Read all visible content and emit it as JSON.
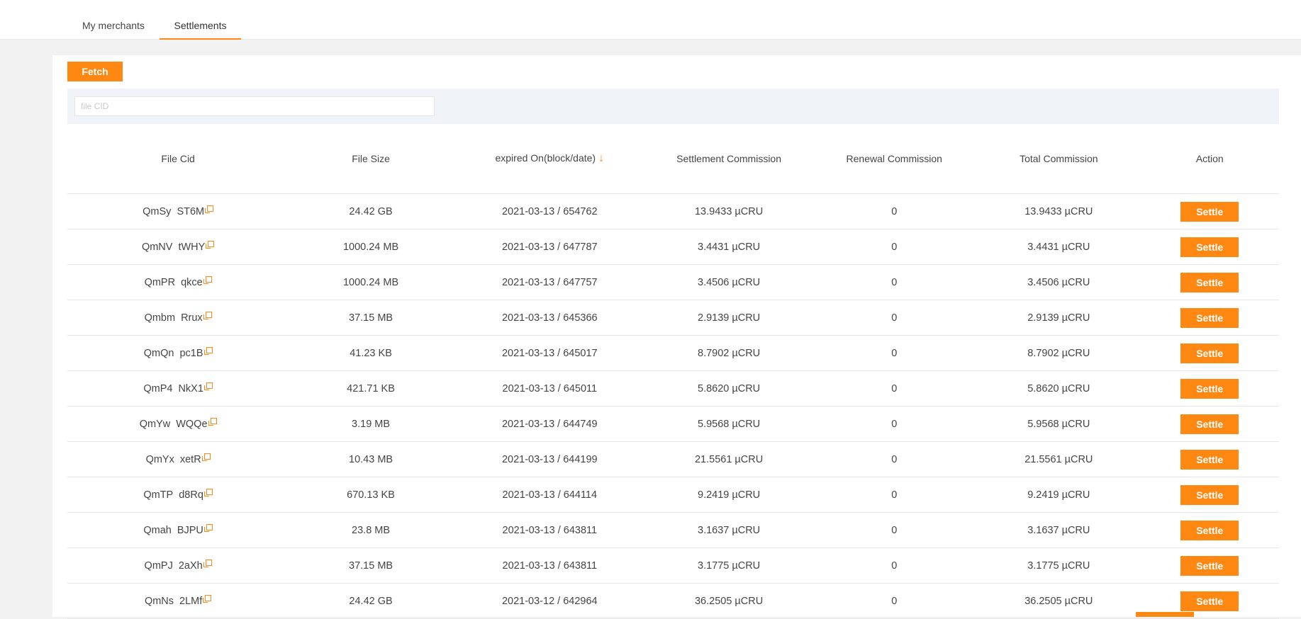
{
  "tabs": [
    {
      "label": "My merchants",
      "active": false
    },
    {
      "label": "Settlements",
      "active": true
    }
  ],
  "toolbar": {
    "fetch_label": "Fetch"
  },
  "filter": {
    "placeholder": "file CID",
    "value": ""
  },
  "table": {
    "columns": [
      "File Cid",
      "File Size",
      "expired On(block/date)",
      "Settlement Commission",
      "Renewal Commission",
      "Total Commission",
      "Action"
    ],
    "sort_indicator": "↓",
    "action_label": "Settle",
    "rows": [
      {
        "cid_start": "QmSy",
        "cid_end": "ST6M",
        "size": "24.42 GB",
        "expired": "2021-03-13 / 654762",
        "settlement": "13.9433 µCRU",
        "renewal": "0",
        "total": "13.9433 µCRU"
      },
      {
        "cid_start": "QmNV",
        "cid_end": "tWHY",
        "size": "1000.24 MB",
        "expired": "2021-03-13 / 647787",
        "settlement": "3.4431 µCRU",
        "renewal": "0",
        "total": "3.4431 µCRU"
      },
      {
        "cid_start": "QmPR",
        "cid_end": "qkce",
        "size": "1000.24 MB",
        "expired": "2021-03-13 / 647757",
        "settlement": "3.4506 µCRU",
        "renewal": "0",
        "total": "3.4506 µCRU"
      },
      {
        "cid_start": "Qmbm",
        "cid_end": "Rrux",
        "size": "37.15 MB",
        "expired": "2021-03-13 / 645366",
        "settlement": "2.9139 µCRU",
        "renewal": "0",
        "total": "2.9139 µCRU"
      },
      {
        "cid_start": "QmQn",
        "cid_end": "pc1B",
        "size": "41.23 KB",
        "expired": "2021-03-13 / 645017",
        "settlement": "8.7902 µCRU",
        "renewal": "0",
        "total": "8.7902 µCRU"
      },
      {
        "cid_start": "QmP4",
        "cid_end": "NkX1",
        "size": "421.71 KB",
        "expired": "2021-03-13 / 645011",
        "settlement": "5.8620 µCRU",
        "renewal": "0",
        "total": "5.8620 µCRU"
      },
      {
        "cid_start": "QmYw",
        "cid_end": "WQQe",
        "size": "3.19 MB",
        "expired": "2021-03-13 / 644749",
        "settlement": "5.9568 µCRU",
        "renewal": "0",
        "total": "5.9568 µCRU"
      },
      {
        "cid_start": "QmYx",
        "cid_end": "xetR",
        "size": "10.43 MB",
        "expired": "2021-03-13 / 644199",
        "settlement": "21.5561 µCRU",
        "renewal": "0",
        "total": "21.5561 µCRU"
      },
      {
        "cid_start": "QmTP",
        "cid_end": "d8Rq",
        "size": "670.13 KB",
        "expired": "2021-03-13 / 644114",
        "settlement": "9.2419 µCRU",
        "renewal": "0",
        "total": "9.2419 µCRU"
      },
      {
        "cid_start": "Qmah",
        "cid_end": "BJPU",
        "size": "23.8 MB",
        "expired": "2021-03-13 / 643811",
        "settlement": "3.1637 µCRU",
        "renewal": "0",
        "total": "3.1637 µCRU"
      },
      {
        "cid_start": "QmPJ",
        "cid_end": "2aXh",
        "size": "37.15 MB",
        "expired": "2021-03-13 / 643811",
        "settlement": "3.1775 µCRU",
        "renewal": "0",
        "total": "3.1775 µCRU"
      },
      {
        "cid_start": "QmNs",
        "cid_end": "2LMf",
        "size": "24.42 GB",
        "expired": "2021-03-12 / 642964",
        "settlement": "36.2505 µCRU",
        "renewal": "0",
        "total": "36.2505 µCRU"
      }
    ]
  },
  "colors": {
    "accent": "#ff8812",
    "filter_bg": "#f0f4f8",
    "page_bg": "#f2f2f2"
  },
  "icons": {
    "copy": "copy-icon",
    "sort": "sort-down-arrow-icon"
  }
}
